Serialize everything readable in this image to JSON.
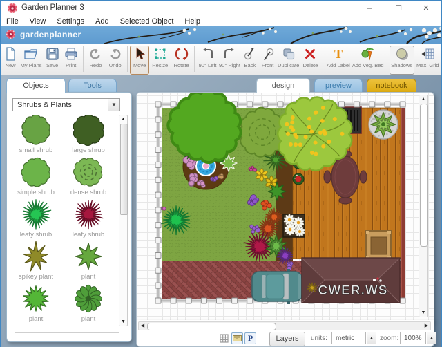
{
  "window": {
    "title": "Garden Planner 3",
    "controls": [
      {
        "name": "minimize",
        "glyph": "–"
      },
      {
        "name": "maximize",
        "glyph": "☐"
      },
      {
        "name": "close",
        "glyph": "✕"
      }
    ]
  },
  "menu": {
    "items": [
      "File",
      "View",
      "Settings",
      "Add",
      "Selected Object",
      "Help"
    ]
  },
  "banner": {
    "logo_text": "gardenplanner"
  },
  "toolbar": {
    "buttons": [
      {
        "label": "New",
        "icon": "new-page-icon"
      },
      {
        "label": "My Plans",
        "icon": "folder-icon"
      },
      {
        "label": "Save",
        "icon": "floppy-icon"
      },
      {
        "label": "Print",
        "icon": "printer-icon"
      },
      {
        "label": "Redo",
        "icon": "redo-arrow-icon"
      },
      {
        "label": "Undo",
        "icon": "undo-arrow-icon"
      },
      {
        "label": "Move",
        "icon": "cursor-icon",
        "selected": true
      },
      {
        "label": "Resize",
        "icon": "resize-frame-icon"
      },
      {
        "label": "Rotate",
        "icon": "rotate-icon"
      },
      {
        "label": "90° Left",
        "icon": "turn-left-icon"
      },
      {
        "label": "90° Right",
        "icon": "turn-right-icon"
      },
      {
        "label": "Back",
        "icon": "send-back-icon"
      },
      {
        "label": "Front",
        "icon": "bring-front-icon"
      },
      {
        "label": "Duplicate",
        "icon": "duplicate-icon"
      },
      {
        "label": "Delete",
        "icon": "delete-x-icon"
      },
      {
        "label": "Add Label",
        "icon": "text-t-icon"
      },
      {
        "label": "Add Veg. Bed",
        "icon": "carrot-icon"
      },
      {
        "label": "Shadows",
        "icon": "shadow-circle-icon",
        "selected": true
      },
      {
        "label": "Max. Grid",
        "icon": "max-grid-icon"
      }
    ]
  },
  "sidebar": {
    "tabs": [
      {
        "label": "Objects",
        "active": true
      },
      {
        "label": "Tools",
        "active": false
      }
    ],
    "category": "Shrubs & Plants",
    "plants": [
      {
        "label": "small shrub",
        "shape": "blob",
        "color": "#68a344",
        "r": 19,
        "n": 10
      },
      {
        "label": "large shrub",
        "shape": "blob",
        "color": "#3f5f23",
        "r": 20,
        "n": 10
      },
      {
        "label": "simple shrub",
        "shape": "blob",
        "color": "#6cb449",
        "r": 19,
        "n": 11
      },
      {
        "label": "dense shrub",
        "shape": "blobdash",
        "color": "#7cb854",
        "r": 19,
        "n": 11
      },
      {
        "label": "leafy shrub",
        "shape": "burst",
        "color": "#25c653",
        "r": 20,
        "n": 24
      },
      {
        "label": "leafy shrub",
        "shape": "burst",
        "color": "#a6173e",
        "r": 20,
        "n": 24
      },
      {
        "label": "spikey plant",
        "shape": "star",
        "color": "#8f8a28",
        "r": 20,
        "n": 9,
        "inner": 0.4,
        "jit": 0.3
      },
      {
        "label": "plant",
        "shape": "star",
        "color": "#66a83e",
        "r": 19,
        "n": 8,
        "inner": 0.45
      },
      {
        "label": "plant",
        "shape": "burst",
        "color": "#54b637",
        "r": 19,
        "n": 14,
        "inner": 0.55,
        "jit": 0.1
      },
      {
        "label": "plant",
        "shape": "flower",
        "color": "#4f9e3a",
        "r": 19,
        "n": 12
      }
    ]
  },
  "canvas_tabs": [
    {
      "label": "design",
      "active": true
    },
    {
      "label": "preview",
      "active": false
    },
    {
      "label": "notebook",
      "active": false
    }
  ],
  "scene": {
    "watermark": "CWER.WS",
    "objects": [
      "lawn",
      "deck",
      "brick-driveway",
      "fence",
      "large-tree",
      "dense-shrub",
      "flowering-tree",
      "flower-bed",
      "pond-fountain",
      "bbq-grill",
      "potted-plant",
      "flower-pots",
      "dining-table-set",
      "daisy-planter",
      "wooden-crate",
      "house-roof",
      "car",
      "flower-border"
    ]
  },
  "statusbar": {
    "layers": "Layers",
    "units_label": "units:",
    "units_value": "metric",
    "zoom_label": "zoom:",
    "zoom_value": "100%"
  },
  "palette": {
    "banner_blue": "#6fa9d8",
    "tab_blue": "#9cc2e0",
    "tab_gold": "#ddab12",
    "lawn_green": "#7ea542",
    "deck_orange": "#c1761d",
    "brick_red": "#9a5150",
    "roof_maroon": "#5e3a3a",
    "pond_blue": "#35a8e0",
    "app_bg": "#8ba1b5"
  }
}
